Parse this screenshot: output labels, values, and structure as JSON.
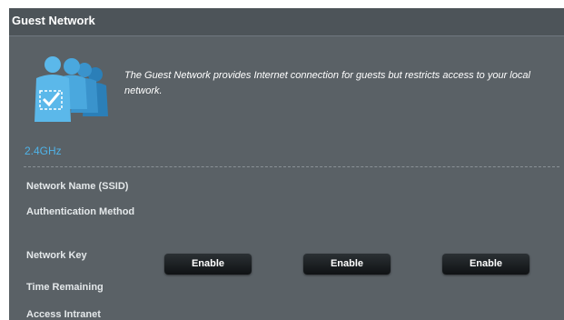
{
  "section": {
    "title": "Guest Network",
    "description": "The Guest Network provides Internet connection for guests but restricts access to your local network.",
    "icon": "guest-users-icon",
    "accent_color": "#4fb3e8"
  },
  "band": {
    "label": "2.4GHz",
    "fields": {
      "network_name": "Network Name (SSID)",
      "authentication_method": "Authentication Method",
      "network_key": "Network Key",
      "time_remaining": "Time Remaining",
      "access_intranet": "Access Intranet"
    },
    "buttons": [
      {
        "label": "Enable"
      },
      {
        "label": "Enable"
      },
      {
        "label": "Enable"
      }
    ]
  }
}
